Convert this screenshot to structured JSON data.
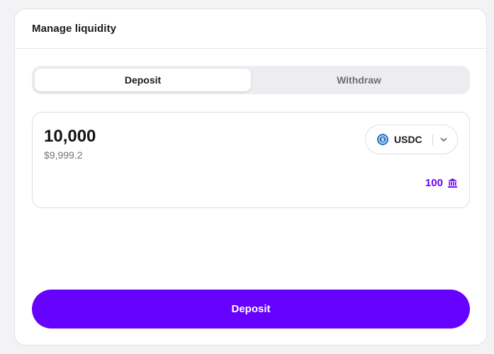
{
  "header": {
    "title": "Manage liquidity"
  },
  "tabs": [
    {
      "label": "Deposit",
      "active": true
    },
    {
      "label": "Withdraw",
      "active": false
    }
  ],
  "amount": {
    "value": "10,000",
    "usd_value": "$9,999.2"
  },
  "token": {
    "symbol": "USDC",
    "icon": "usdc-icon"
  },
  "balance": {
    "value": "100",
    "icon": "bank-icon"
  },
  "action": {
    "label": "Deposit"
  },
  "colors": {
    "accent": "#6600ff",
    "balance_text": "#6b00f5",
    "usdc_blue": "#2775ca"
  }
}
